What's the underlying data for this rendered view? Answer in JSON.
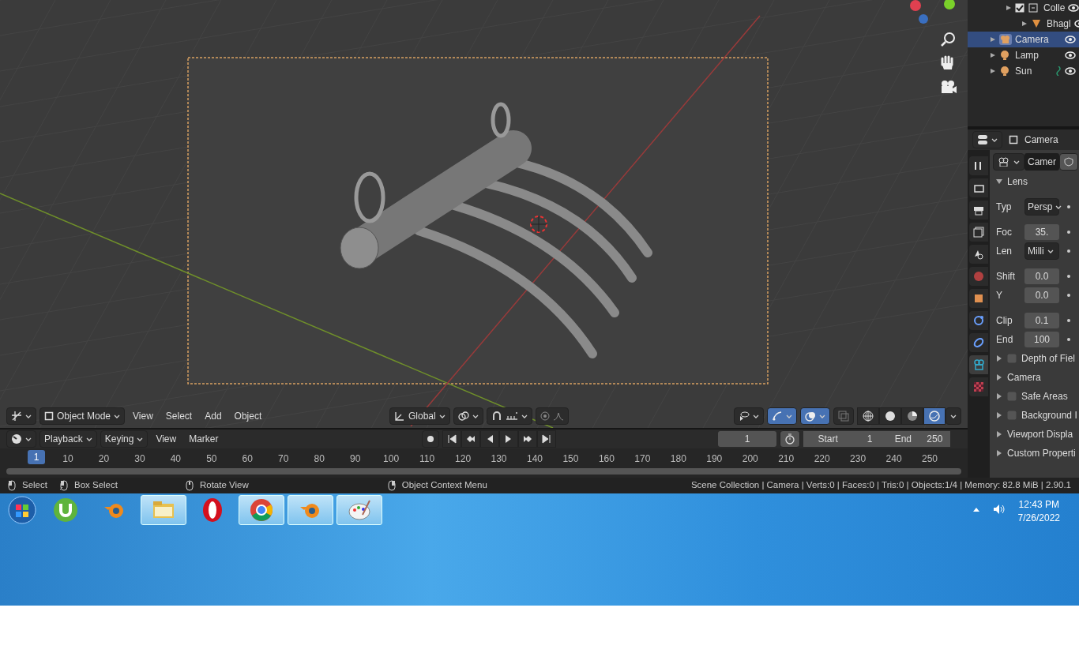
{
  "viewport": {
    "mode": "Object Mode",
    "menus": [
      "View",
      "Select",
      "Add",
      "Object"
    ],
    "orientation": "Global",
    "gizmos_on": true,
    "overlays_on": true,
    "xray_on": false,
    "shading": [
      {
        "kind": "wireframe",
        "selected": false
      },
      {
        "kind": "solid",
        "selected": false
      },
      {
        "kind": "material",
        "selected": false
      },
      {
        "kind": "rendered",
        "selected": true
      }
    ]
  },
  "timeline": {
    "menus": [
      {
        "kind": "dropdown",
        "label": "Playback"
      },
      {
        "kind": "dropdown",
        "label": "Keying"
      },
      {
        "kind": "menu",
        "label": "View"
      },
      {
        "kind": "menu",
        "label": "Marker"
      }
    ],
    "current_frame": "1",
    "start": {
      "label": "Start",
      "value": "1"
    },
    "end": {
      "label": "End",
      "value": "250"
    },
    "ruler": {
      "current": "1",
      "ticks": [
        "10",
        "20",
        "30",
        "40",
        "50",
        "60",
        "70",
        "80",
        "90",
        "100",
        "110",
        "120",
        "130",
        "140",
        "150",
        "160",
        "170",
        "180",
        "190",
        "200",
        "210",
        "220",
        "230",
        "240",
        "250"
      ]
    }
  },
  "outliner": {
    "items": [
      {
        "kind": "collection",
        "label": "Colle",
        "checked": true,
        "selected": false,
        "constraint": false,
        "children": [
          {
            "kind": "mesh",
            "label": "Bhagl",
            "selected": false,
            "constraint": false
          }
        ]
      },
      {
        "kind": "camera",
        "label": "Camera",
        "selected": true,
        "constraint": false
      },
      {
        "kind": "light",
        "label": "Lamp",
        "selected": false,
        "constraint": false
      },
      {
        "kind": "light",
        "label": "Sun",
        "selected": false,
        "constraint": true
      }
    ]
  },
  "properties": {
    "header": "Camera",
    "datablock": "Camer",
    "tabs": [
      {
        "kind": "tool",
        "selected": false
      },
      {
        "kind": "render",
        "selected": false
      },
      {
        "kind": "output",
        "selected": false
      },
      {
        "kind": "view_layer",
        "selected": false
      },
      {
        "kind": "scene",
        "selected": false
      },
      {
        "kind": "world",
        "selected": false
      },
      {
        "kind": "object",
        "selected": false
      },
      {
        "kind": "physics",
        "selected": false
      },
      {
        "kind": "constraints",
        "selected": false
      },
      {
        "kind": "data",
        "selected": true
      },
      {
        "kind": "texture",
        "selected": false
      }
    ],
    "panels": [
      {
        "kind": "plain",
        "title": "Lens",
        "expanded": true,
        "fields": [
          {
            "kind": "dropdown",
            "label": "Typ",
            "value": "Persp",
            "group_start": true
          },
          {
            "kind": "number",
            "label": "Foc",
            "value": "35.",
            "group_start": true
          },
          {
            "kind": "dropdown",
            "label": "Len",
            "value": "Milli",
            "group_start": false
          },
          {
            "kind": "number",
            "label": "Shift",
            "value": "0.0",
            "group_start": true
          },
          {
            "kind": "number",
            "label": "Y",
            "value": "0.0",
            "group_start": false
          },
          {
            "kind": "number",
            "label": "Clip",
            "value": "0.1",
            "group_start": true
          },
          {
            "kind": "number",
            "label": "End",
            "value": "100",
            "group_start": false
          }
        ]
      },
      {
        "kind": "checkbox",
        "title": "Depth of Fiel",
        "expanded": false,
        "checked": false
      },
      {
        "kind": "plain",
        "title": "Camera",
        "expanded": false
      },
      {
        "kind": "checkbox",
        "title": "Safe Areas",
        "expanded": false,
        "checked": false
      },
      {
        "kind": "checkbox",
        "title": "Background I",
        "expanded": false,
        "checked": false
      },
      {
        "kind": "plain",
        "title": "Viewport Displa",
        "expanded": false
      },
      {
        "kind": "plain",
        "title": "Custom Properti",
        "expanded": false
      }
    ]
  },
  "status_bar": {
    "hints": [
      {
        "kind": "left",
        "label": "Select"
      },
      {
        "kind": "drag",
        "label": "Box Select"
      },
      {
        "kind": "middle",
        "label": "Rotate View"
      },
      {
        "kind": "right",
        "label": "Object Context Menu"
      }
    ],
    "stats": "Scene Collection | Camera | Verts:0 | Faces:0 | Tris:0 | Objects:1/4 | Memory: 82.8 MiB | 2.90.1"
  },
  "taskbar": {
    "apps": [
      {
        "kind": "torrent",
        "open": false
      },
      {
        "kind": "blender",
        "open": false
      },
      {
        "kind": "folder",
        "open": true
      },
      {
        "kind": "opera",
        "open": false
      },
      {
        "kind": "chrome",
        "open": true
      },
      {
        "kind": "blender",
        "open": true
      },
      {
        "kind": "paint",
        "open": true
      }
    ],
    "time": "12:43 PM",
    "date": "7/26/2022"
  }
}
